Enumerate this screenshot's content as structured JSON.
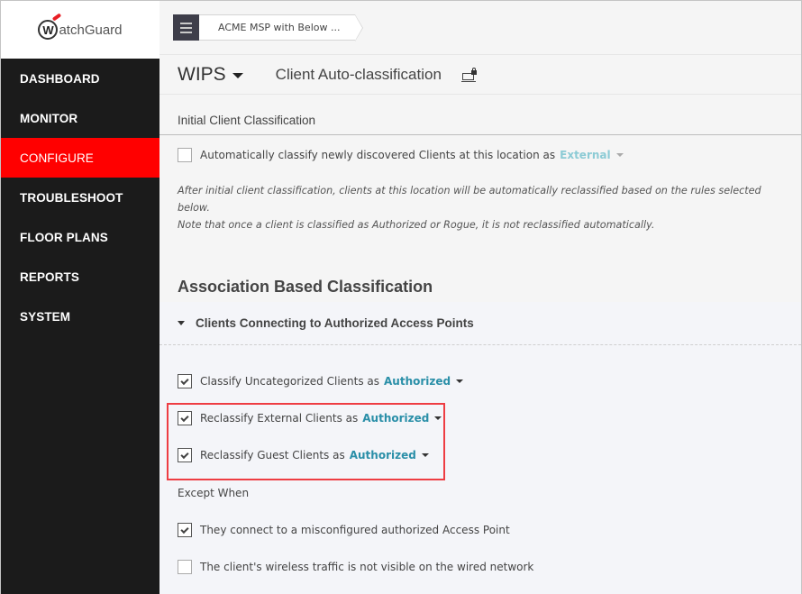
{
  "brand": {
    "logo_text": "atchGuard",
    "logo_initial": "W",
    "accent_color": "#ff0000"
  },
  "sidebar": {
    "items": [
      {
        "label": "DASHBOARD",
        "active": false
      },
      {
        "label": "MONITOR",
        "active": false
      },
      {
        "label": "CONFIGURE",
        "active": true
      },
      {
        "label": "TROUBLESHOOT",
        "active": false
      },
      {
        "label": "FLOOR PLANS",
        "active": false
      },
      {
        "label": "REPORTS",
        "active": false
      },
      {
        "label": "SYSTEM",
        "active": false
      }
    ]
  },
  "topbar": {
    "menu_icon": "hamburger-icon",
    "breadcrumb": "ACME MSP with Below ..."
  },
  "header": {
    "module": "WIPS",
    "page_title": "Client Auto-classification",
    "lock_icon": "locked-device-icon"
  },
  "initial": {
    "heading": "Initial Client Classification",
    "auto_classify": {
      "label": "Automatically classify newly discovered Clients at this location as",
      "checked": false,
      "value": "External"
    },
    "note_line1": "After initial client classification, clients at this location will be automatically reclassified based on the rules selected below.",
    "note_line2": "Note that once a client is classified as Authorized or Rogue, it is not reclassified automatically."
  },
  "association": {
    "heading": "Association Based Classification",
    "group_heading": "Clients Connecting to Authorized Access Points",
    "rules": [
      {
        "label": "Classify Uncategorized Clients as",
        "checked": true,
        "value": "Authorized"
      },
      {
        "label": "Reclassify External Clients as",
        "checked": true,
        "value": "Authorized"
      },
      {
        "label": "Reclassify Guest Clients as",
        "checked": true,
        "value": "Authorized"
      }
    ],
    "except_label": "Except When",
    "exceptions": [
      {
        "label": "They connect to a misconfigured authorized Access Point",
        "checked": true
      },
      {
        "label": "The client's wireless traffic is not visible on the wired network",
        "checked": false
      }
    ]
  }
}
